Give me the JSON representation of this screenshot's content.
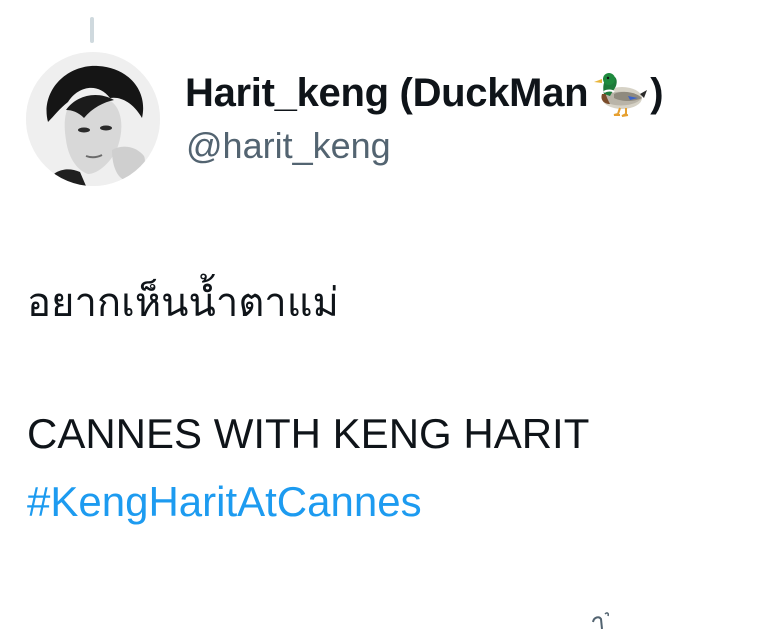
{
  "author": {
    "display_name": "Harit_keng (DuckMan",
    "display_name_close": ")",
    "emoji_icon": "mallard-duck-icon",
    "handle": "@harit_keng"
  },
  "tweet": {
    "thai_line": "อยากเห็นน้ำตาแม่",
    "english_line": "CANNES WITH KENG HARIT",
    "hashtag": "#KengHaritAtCannes"
  },
  "colors": {
    "text": "#0f1419",
    "secondary": "#536471",
    "link": "#1d9bf0",
    "thread_line": "#cfd9de"
  }
}
